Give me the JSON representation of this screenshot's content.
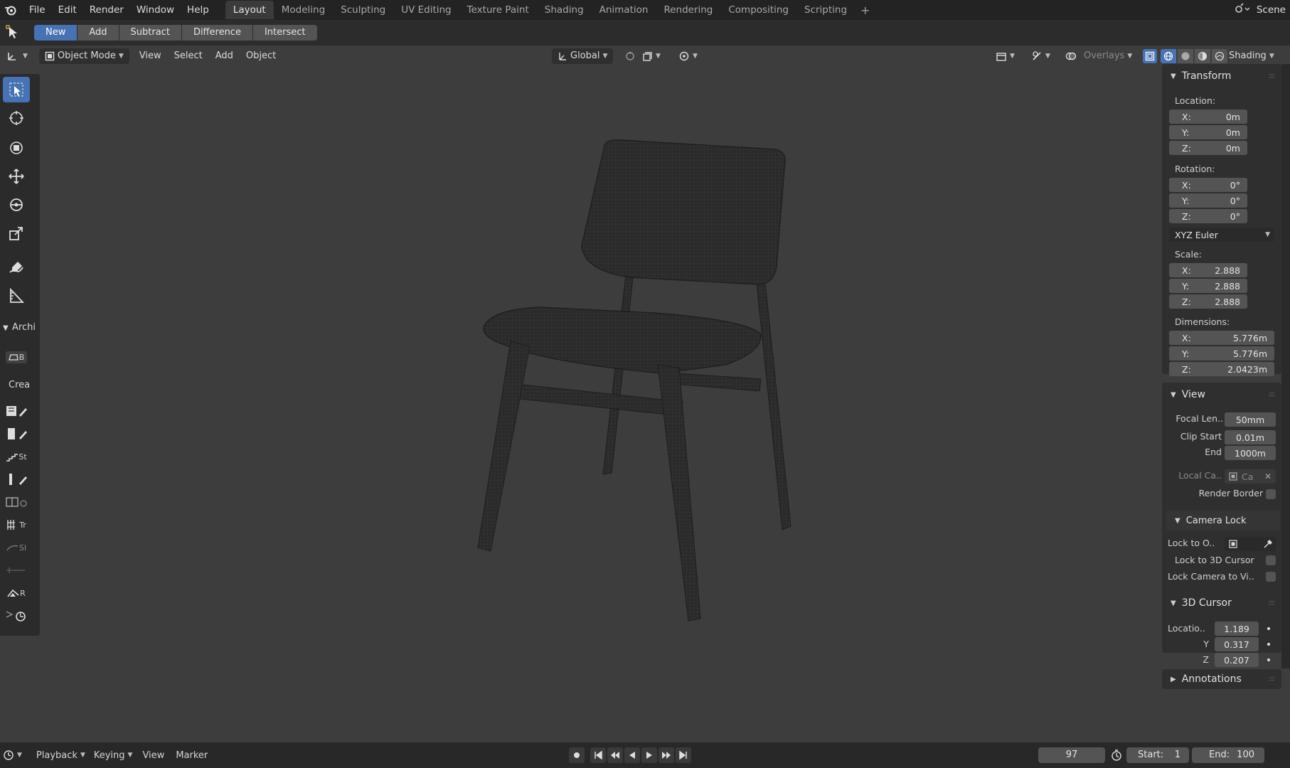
{
  "topbar": {
    "menus": [
      "File",
      "Edit",
      "Render",
      "Window",
      "Help"
    ],
    "workspaces": [
      "Layout",
      "Modeling",
      "Sculpting",
      "UV Editing",
      "Texture Paint",
      "Shading",
      "Animation",
      "Rendering",
      "Compositing",
      "Scripting"
    ],
    "active_workspace": "Layout",
    "add_tab": "+",
    "scene": "Scene"
  },
  "toolheader": {
    "bool_buttons": [
      "New",
      "Add",
      "Subtract",
      "Difference",
      "Intersect"
    ],
    "active": "New"
  },
  "viewport_header": {
    "mode": "Object Mode",
    "menus": [
      "View",
      "Select",
      "Add",
      "Object"
    ],
    "orientation": "Global",
    "overlays": "Overlays",
    "shading": "Shading"
  },
  "toolbar": {
    "section_label": "Archi",
    "create_label": "Crea",
    "addon_labels": [
      "B",
      "St",
      "Tr",
      "Sl",
      "R"
    ]
  },
  "npanel": {
    "transform": {
      "title": "Transform",
      "location_label": "Location:",
      "location": [
        {
          "axis": "X:",
          "value": "0m"
        },
        {
          "axis": "Y:",
          "value": "0m"
        },
        {
          "axis": "Z:",
          "value": "0m"
        }
      ],
      "rotation_label": "Rotation:",
      "rotation": [
        {
          "axis": "X:",
          "value": "0°"
        },
        {
          "axis": "Y:",
          "value": "0°"
        },
        {
          "axis": "Z:",
          "value": "0°"
        }
      ],
      "rotation_mode": "XYZ Euler",
      "scale_label": "Scale:",
      "scale": [
        {
          "axis": "X:",
          "value": "2.888"
        },
        {
          "axis": "Y:",
          "value": "2.888"
        },
        {
          "axis": "Z:",
          "value": "2.888"
        }
      ],
      "dimensions_label": "Dimensions:",
      "dimensions": [
        {
          "axis": "X:",
          "value": "5.776m"
        },
        {
          "axis": "Y:",
          "value": "5.776m"
        },
        {
          "axis": "Z:",
          "value": "2.0423m"
        }
      ]
    },
    "view": {
      "title": "View",
      "focal_label": "Focal Len..",
      "focal_value": "50mm",
      "clip_start_label": "Clip Start",
      "clip_start_value": "0.01m",
      "clip_end_label": "End",
      "clip_end_value": "1000m",
      "local_camera_label": "Local Ca..",
      "local_camera_value": "Ca",
      "render_border_label": "Render Border"
    },
    "camera_lock": {
      "title": "Camera Lock",
      "lock_to_object_label": "Lock to O..",
      "lock_3d_cursor_label": "Lock to 3D Cursor",
      "lock_camera_view_label": "Lock Camera to Vi.."
    },
    "cursor": {
      "title": "3D Cursor",
      "location_label": "Locatio..",
      "x": "1.189",
      "y_label": "Y",
      "y": "0.317",
      "z_label": "Z",
      "z": "0.207"
    },
    "annotations": {
      "title": "Annotations"
    }
  },
  "timeline": {
    "menus": [
      "Playback",
      "Keying",
      "View",
      "Marker"
    ],
    "current_frame": "97",
    "start_label": "Start:",
    "start_value": "1",
    "end_label": "End:",
    "end_value": "100"
  }
}
